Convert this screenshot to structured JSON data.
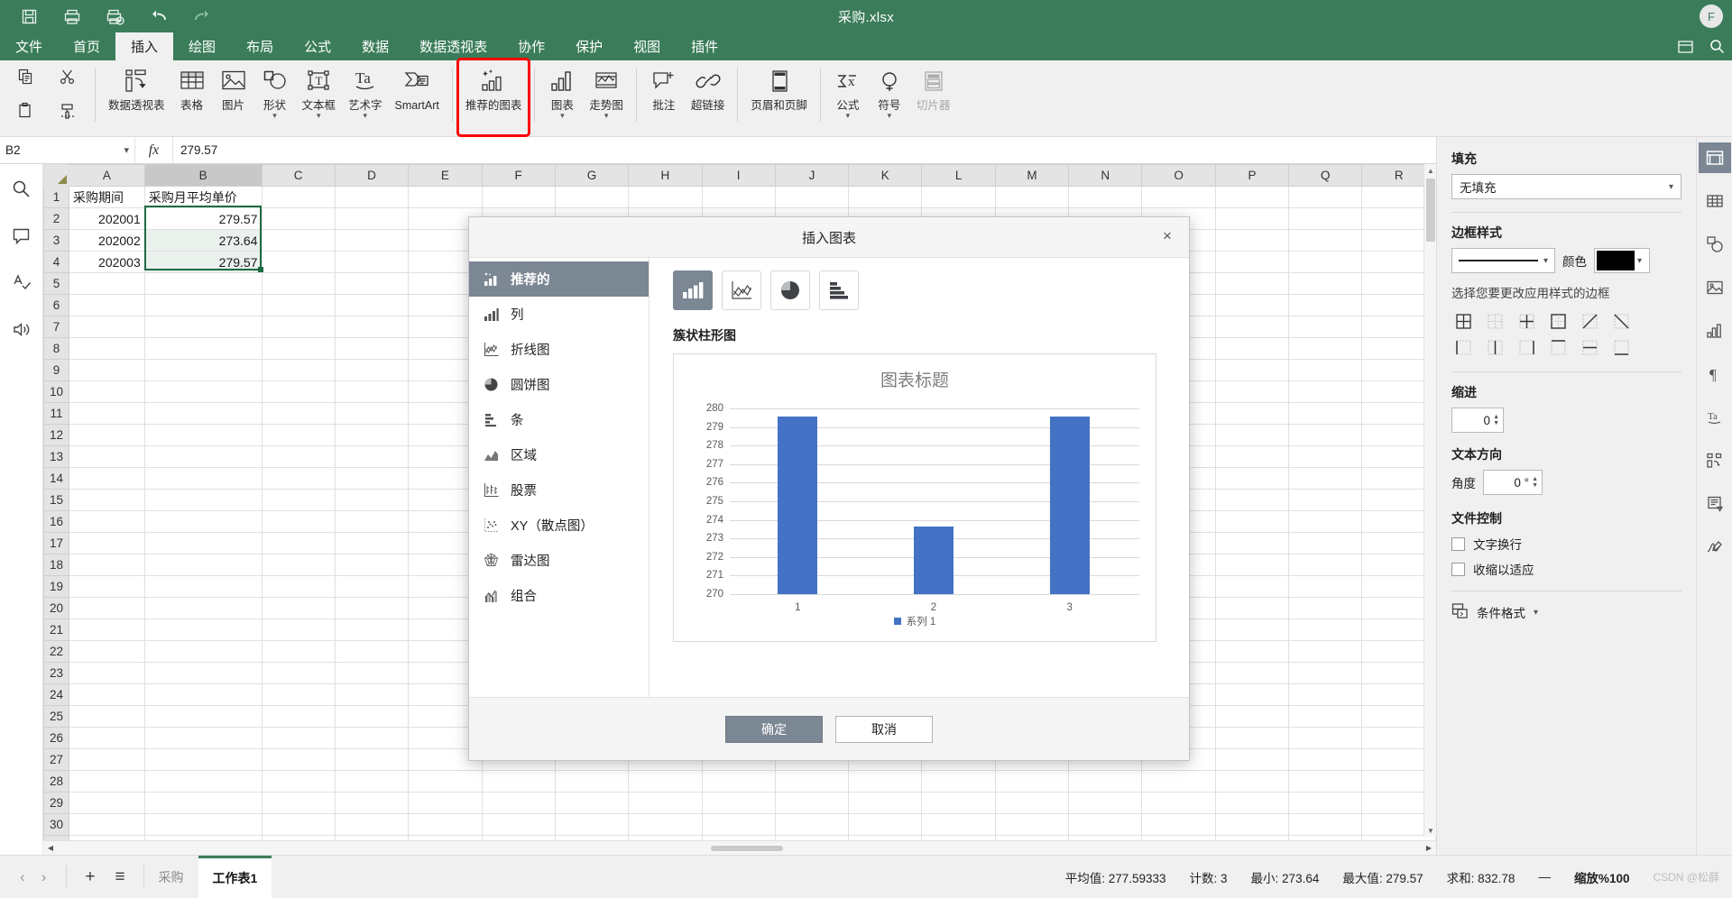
{
  "titlebar": {
    "document_title": "采购.xlsx",
    "quick_access": [
      {
        "name": "save-icon",
        "label": "保存"
      },
      {
        "name": "print-icon",
        "label": "打印"
      },
      {
        "name": "print-preview-icon",
        "label": "打印预览"
      },
      {
        "name": "undo-icon",
        "label": "撤销"
      },
      {
        "name": "redo-icon",
        "label": "恢复"
      }
    ],
    "avatar_letter": "F"
  },
  "tabs": [
    {
      "label": "文件",
      "active": false
    },
    {
      "label": "首页",
      "active": false
    },
    {
      "label": "插入",
      "active": true
    },
    {
      "label": "绘图",
      "active": false
    },
    {
      "label": "布局",
      "active": false
    },
    {
      "label": "公式",
      "active": false
    },
    {
      "label": "数据",
      "active": false
    },
    {
      "label": "数据透视表",
      "active": false
    },
    {
      "label": "协作",
      "active": false
    },
    {
      "label": "保护",
      "active": false
    },
    {
      "label": "视图",
      "active": false
    },
    {
      "label": "插件",
      "active": false
    }
  ],
  "ribbon": {
    "clipboard": [
      {
        "label": "",
        "icon": "copy-icon"
      },
      {
        "label": "",
        "icon": "cut-icon"
      },
      {
        "label": "",
        "icon": "paste-icon"
      },
      {
        "label": "",
        "icon": "format-painter-icon"
      }
    ],
    "items": [
      {
        "label": "数据透视表",
        "icon": "pivot-table-icon",
        "highlighted": false
      },
      {
        "label": "表格",
        "icon": "table-icon",
        "highlighted": false
      },
      {
        "label": "图片",
        "icon": "picture-icon",
        "highlighted": false
      },
      {
        "label": "形状",
        "icon": "shapes-icon",
        "caret": true,
        "highlighted": false
      },
      {
        "label": "文本框",
        "icon": "text-box-icon",
        "caret": true,
        "highlighted": false
      },
      {
        "label": "艺术字",
        "icon": "word-art-icon",
        "caret": true,
        "highlighted": false
      },
      {
        "label": "SmartArt",
        "icon": "smartart-icon",
        "highlighted": false
      },
      {
        "label": "推荐的图表",
        "icon": "recommended-charts-icon",
        "highlighted": true
      },
      {
        "label": "图表",
        "icon": "chart-icon",
        "caret": true,
        "highlighted": false
      },
      {
        "label": "走势图",
        "icon": "sparkline-icon",
        "caret": true,
        "highlighted": false
      },
      {
        "label": "批注",
        "icon": "comment-icon",
        "highlighted": false
      },
      {
        "label": "超链接",
        "icon": "hyperlink-icon",
        "highlighted": false
      },
      {
        "label": "页眉和页脚",
        "icon": "header-footer-icon",
        "highlighted": false
      },
      {
        "label": "公式",
        "icon": "equation-icon",
        "caret": true,
        "highlighted": false
      },
      {
        "label": "符号",
        "icon": "symbol-icon",
        "caret": true,
        "highlighted": false
      },
      {
        "label": "切片器",
        "icon": "slicer-icon",
        "highlighted": false,
        "disabled": true
      }
    ]
  },
  "formula_bar": {
    "name_box": "B2",
    "fx_label": "fx",
    "formula": "279.57"
  },
  "grid": {
    "columns": [
      "A",
      "B",
      "C",
      "D",
      "E",
      "F",
      "G",
      "H",
      "I",
      "J",
      "K",
      "L",
      "M",
      "N",
      "O",
      "P",
      "Q",
      "R"
    ],
    "selected_column": "B",
    "row_count": 31,
    "selected_row": 2,
    "rows": [
      {
        "n": 1,
        "A": "采购期间",
        "B": "采购月平均单价"
      },
      {
        "n": 2,
        "A": "202001",
        "B": "279.57"
      },
      {
        "n": 3,
        "A": "202002",
        "B": "273.64"
      },
      {
        "n": 4,
        "A": "202003",
        "B": "279.57"
      }
    ]
  },
  "right_panel": {
    "fill": {
      "heading": "填充",
      "value": "无填充"
    },
    "border_style": {
      "heading": "边框样式",
      "color_label": "颜色",
      "color_value": "#000000",
      "note": "选择您要更改应用样式的边框"
    },
    "indent": {
      "heading": "缩进",
      "value": "0"
    },
    "text_direction": {
      "heading": "文本方向",
      "angle_label": "角度",
      "angle_value": "0 °"
    },
    "file_control": {
      "heading": "文件控制",
      "wrap_text": "文字换行",
      "shrink_to_fit": "收缩以适应"
    },
    "conditional_format": "条件格式",
    "side_icons": [
      {
        "name": "layout-panel-icon",
        "active": true
      },
      {
        "name": "table-panel-icon",
        "active": false
      },
      {
        "name": "shape-panel-icon",
        "active": false
      },
      {
        "name": "image-panel-icon",
        "active": false
      },
      {
        "name": "chart-panel-icon",
        "active": false
      },
      {
        "name": "paragraph-panel-icon",
        "active": false
      },
      {
        "name": "wordart-panel-icon",
        "active": false
      },
      {
        "name": "transform-panel-icon",
        "active": false
      },
      {
        "name": "document-panel-icon",
        "active": false
      },
      {
        "name": "signature-panel-icon",
        "active": false
      }
    ]
  },
  "left_rail": [
    {
      "name": "search-icon"
    },
    {
      "name": "comment-icon"
    },
    {
      "name": "spell-check-icon"
    },
    {
      "name": "read-aloud-icon"
    }
  ],
  "dialog": {
    "title": "插入图表",
    "close_label": "×",
    "categories": [
      {
        "label": "推荐的",
        "icon": "recommended-icon",
        "active": true
      },
      {
        "label": "列",
        "icon": "column-chart-icon",
        "active": false
      },
      {
        "label": "折线图",
        "icon": "line-chart-icon",
        "active": false
      },
      {
        "label": "圆饼图",
        "icon": "pie-chart-icon",
        "active": false
      },
      {
        "label": "条",
        "icon": "bar-chart-icon",
        "active": false
      },
      {
        "label": "区域",
        "icon": "area-chart-icon",
        "active": false
      },
      {
        "label": "股票",
        "icon": "stock-chart-icon",
        "active": false
      },
      {
        "label": "XY（散点图）",
        "icon": "scatter-chart-icon",
        "active": false
      },
      {
        "label": "雷达图",
        "icon": "radar-chart-icon",
        "active": false
      },
      {
        "label": "组合",
        "icon": "combo-chart-icon",
        "active": false
      }
    ],
    "type_buttons": [
      {
        "name": "clustered-column-type",
        "active": true
      },
      {
        "name": "line-type",
        "active": false
      },
      {
        "name": "pie-type",
        "active": false
      },
      {
        "name": "bar-type",
        "active": false
      }
    ],
    "chart_name": "簇状柱形图",
    "buttons": {
      "ok": "确定",
      "cancel": "取消"
    }
  },
  "chart_data": {
    "type": "bar",
    "title": "图表标题",
    "categories": [
      "1",
      "2",
      "3"
    ],
    "series": [
      {
        "name": "系列 1",
        "values": [
          279.57,
          273.64,
          279.57
        ],
        "color": "#4472C4"
      }
    ],
    "xlabel": "",
    "ylabel": "",
    "ylim": [
      270,
      280
    ],
    "yticks": [
      280,
      279,
      278,
      277,
      276,
      275,
      274,
      273,
      272,
      271,
      270
    ],
    "grid": true,
    "legend_position": "bottom"
  },
  "status_bar": {
    "sheet_nav": {
      "prev": "‹",
      "next": "›"
    },
    "add_sheet": "+",
    "sheet_list": "≡",
    "sheets": [
      {
        "label": "采购",
        "active": false
      },
      {
        "label": "工作表1",
        "active": true
      }
    ],
    "stats": [
      {
        "label": "平均值",
        "value": "277.59333"
      },
      {
        "label": "计数",
        "value": "3"
      },
      {
        "label": "最小",
        "value": "273.64"
      },
      {
        "label": "最大值",
        "value": "279.57"
      },
      {
        "label": "求和",
        "value": "832.78"
      }
    ],
    "minimize": "—",
    "zoom": "缩放%100",
    "watermark": "CSDN @松薛"
  }
}
